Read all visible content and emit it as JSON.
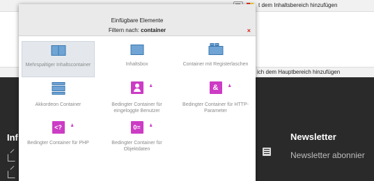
{
  "top_bar": {
    "text": "t dem Inhaltsbereich hinzufügen"
  },
  "mid_bar": {
    "text": "ich dem Hauptbereich hinzufügen"
  },
  "footer": {
    "heading_left": "Inf",
    "heading_right": "Newsletter",
    "text_right": "Newsletter abonnier"
  },
  "modal": {
    "title": "Einfügbare Elemente",
    "filter_prefix": "Filtern nach:",
    "filter_value": "container",
    "close": "×",
    "items": [
      {
        "label": "Mehrspaltiger Inhaltscontainer"
      },
      {
        "label": "Inhaltsbox"
      },
      {
        "label": "Container mit Registerlaschen"
      },
      {
        "label": "Akkordeon Container"
      },
      {
        "label": "Bedingter Container für eingeloggte Benutzer"
      },
      {
        "label": "Bedingter Container für HTTP-Parameter"
      },
      {
        "label": "Bedingter Container für PHP"
      },
      {
        "label": "Bedingter Container für Objektdaten"
      }
    ],
    "icon_glyphs": {
      "http": "&",
      "php": "<?",
      "object": "0="
    }
  },
  "colors": {
    "accent_blue": "#6fa4d4",
    "accent_pink": "#cc3cc4",
    "close_red": "#d9221b",
    "footer_bg": "#2a2a2a"
  }
}
